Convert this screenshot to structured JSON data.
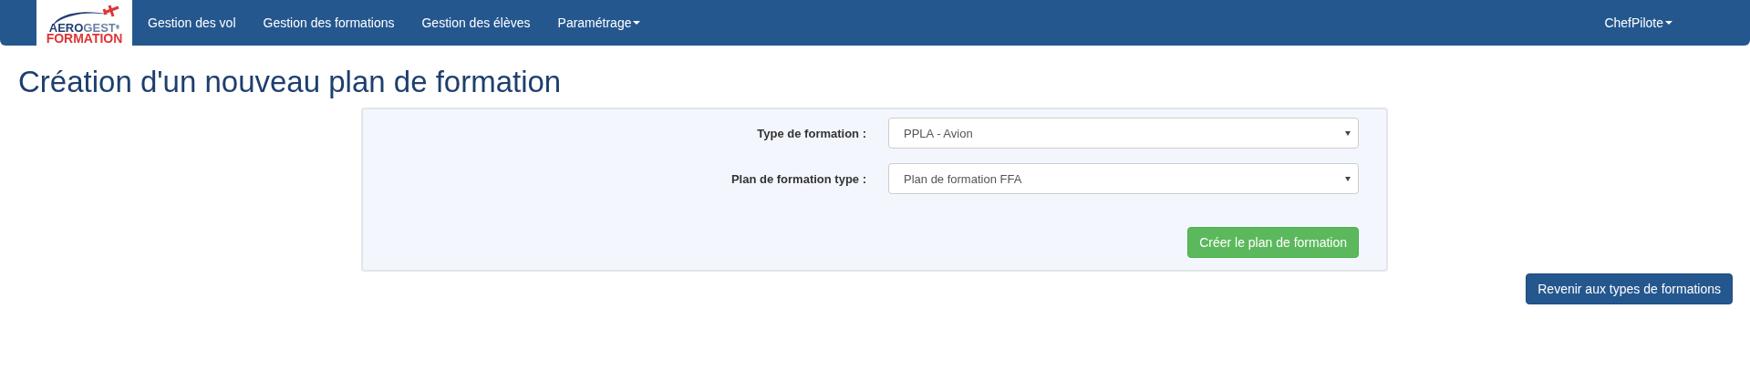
{
  "navbar": {
    "logo": {
      "brand_dark": "AERO",
      "brand_light": "GEST",
      "registered": "®",
      "subtitle": "FORMATION"
    },
    "items": [
      {
        "label": "Gestion des vol",
        "dropdown": false
      },
      {
        "label": "Gestion des formations",
        "dropdown": false
      },
      {
        "label": "Gestion des élèves",
        "dropdown": false
      },
      {
        "label": "Paramétrage",
        "dropdown": true
      }
    ],
    "user": {
      "label": "ChefPilote",
      "dropdown": true
    }
  },
  "page_title": "Création d'un nouveau plan de formation",
  "form": {
    "fields": [
      {
        "label": "Type de formation :",
        "value": "PPLA - Avion"
      },
      {
        "label": "Plan de formation type :",
        "value": "Plan de formation FFA"
      }
    ],
    "submit": "Créer le plan de formation"
  },
  "back_button": "Revenir aux types de formations"
}
